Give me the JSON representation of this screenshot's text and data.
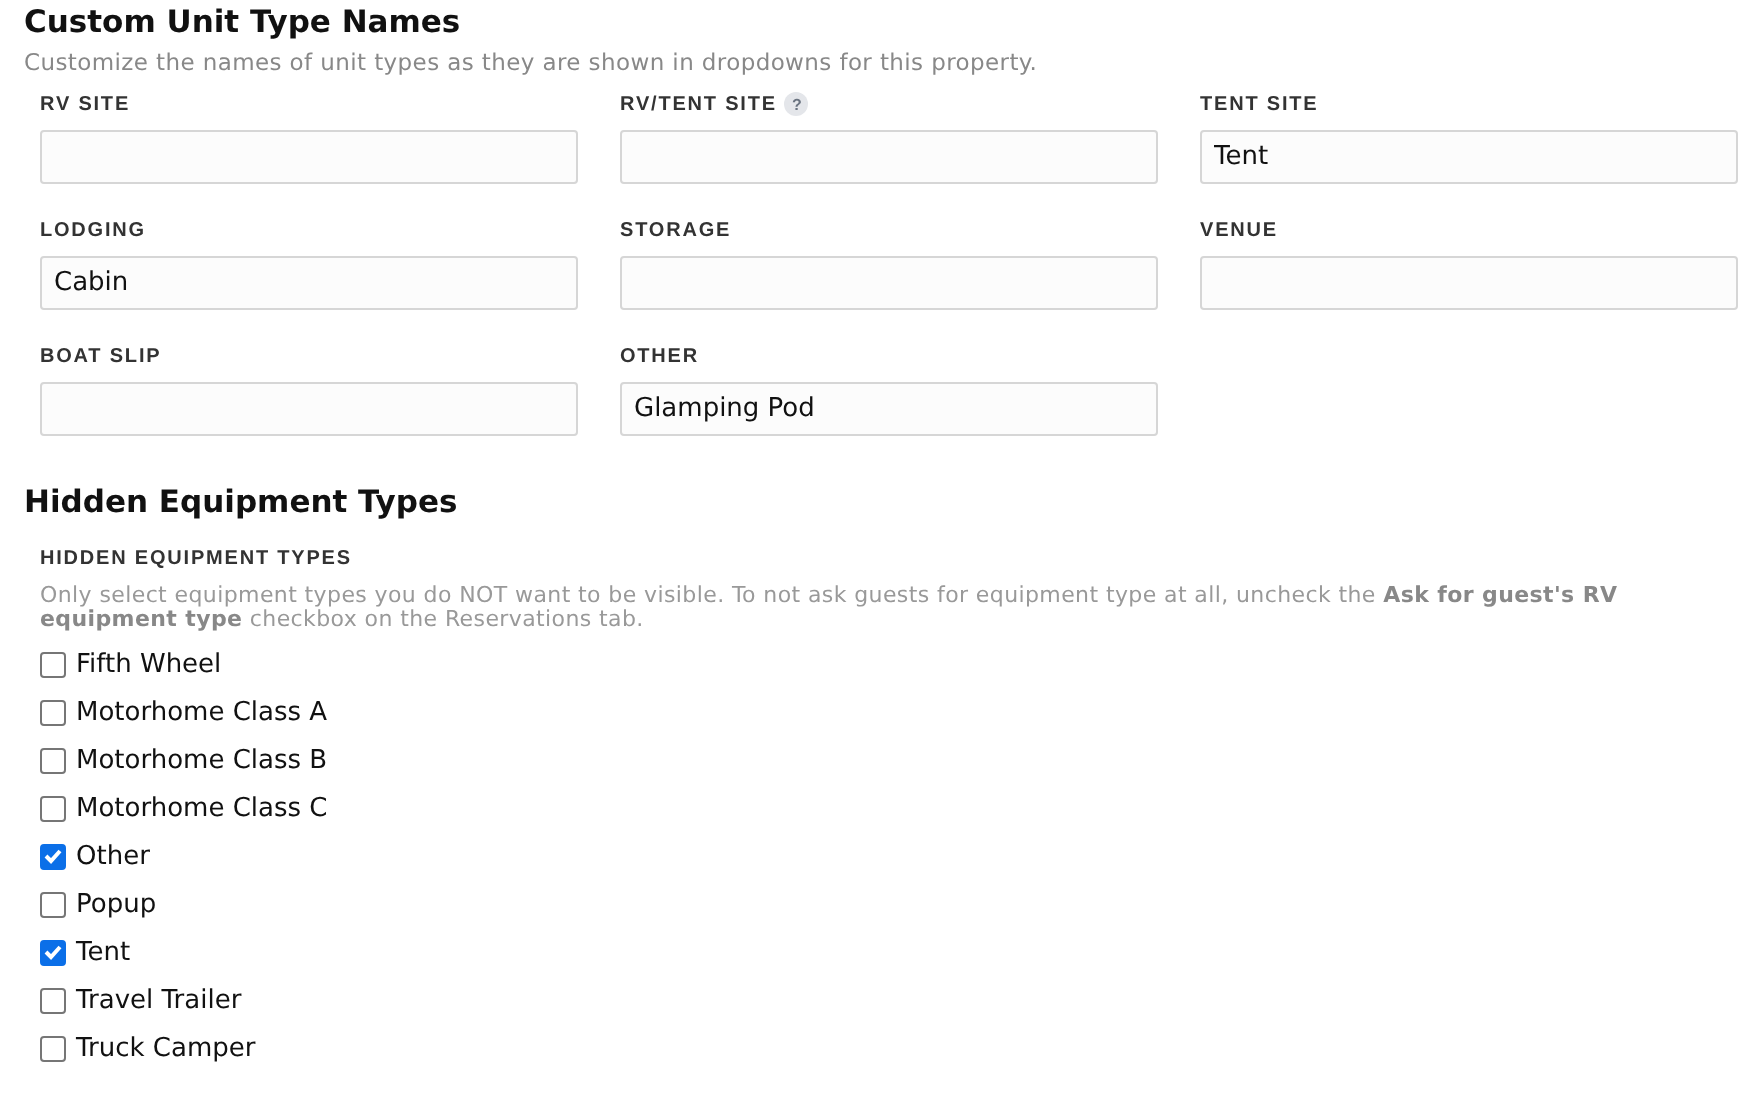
{
  "unit_types": {
    "title": "Custom Unit Type Names",
    "subtitle": "Customize the names of unit types as they are shown in dropdowns for this property.",
    "fields": [
      {
        "label": "RV SITE"
      },
      {
        "label": "RV/TENT SITE",
        "help": "?"
      },
      {
        "label": "TENT SITE",
        "value": "Tent"
      },
      {
        "label": "LODGING",
        "value": "Cabin"
      },
      {
        "label": "STORAGE"
      },
      {
        "label": "VENUE"
      },
      {
        "label": "BOAT SLIP"
      },
      {
        "label": "OTHER",
        "value": "Glamping Pod"
      }
    ]
  },
  "hidden_equipment": {
    "title": "Hidden Equipment Types",
    "label": "HIDDEN EQUIPMENT TYPES",
    "description": "Only select equipment types you do NOT want to be visible. To not ask guests for equipment type at all, uncheck the **Ask for guest's RV equipment type** checkbox on the Reservations tab.",
    "options": [
      {
        "label": "Fifth Wheel",
        "checked": false
      },
      {
        "label": "Motorhome Class A",
        "checked": false
      },
      {
        "label": "Motorhome Class B",
        "checked": false
      },
      {
        "label": "Motorhome Class C",
        "checked": false
      },
      {
        "label": "Other",
        "checked": true
      },
      {
        "label": "Popup",
        "checked": false
      },
      {
        "label": "Tent",
        "checked": true
      },
      {
        "label": "Travel Trailer",
        "checked": false
      },
      {
        "label": "Truck Camper",
        "checked": false
      }
    ]
  }
}
